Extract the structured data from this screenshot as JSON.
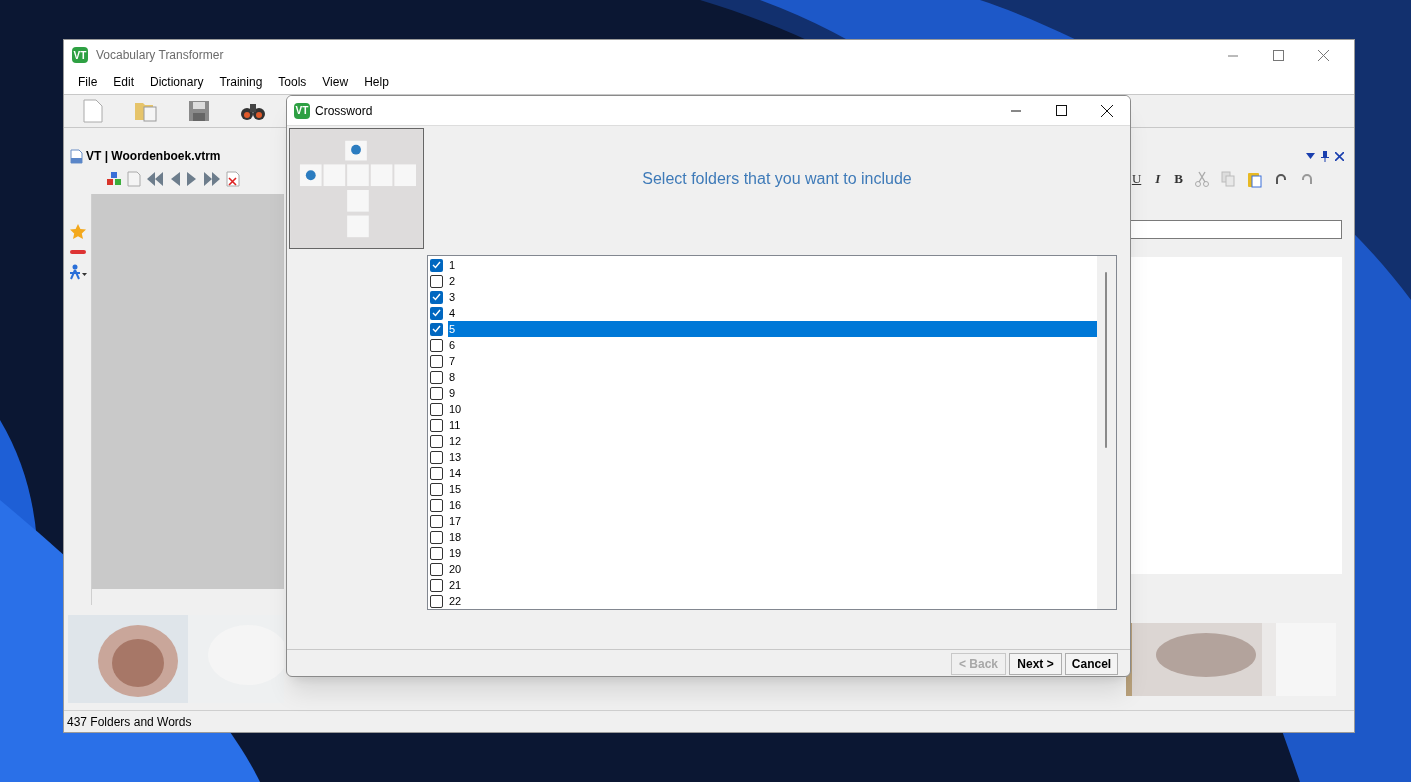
{
  "main_window": {
    "logo": "VT",
    "title": "Vocabulary Transformer",
    "menu": [
      "File",
      "Edit",
      "Dictionary",
      "Training",
      "Tools",
      "View",
      "Help"
    ],
    "document_tab": "VT | Woordenboek.vtrm",
    "format_buttons": [
      "U",
      "I",
      "B"
    ],
    "status_bar": "437 Folders and Words"
  },
  "dialog": {
    "logo": "VT",
    "title": "Crossword",
    "heading": "Select folders that you want to include",
    "folders": [
      {
        "label": "1",
        "checked": true,
        "selected": false
      },
      {
        "label": "2",
        "checked": false,
        "selected": false
      },
      {
        "label": "3",
        "checked": true,
        "selected": false
      },
      {
        "label": "4",
        "checked": true,
        "selected": false
      },
      {
        "label": "5",
        "checked": true,
        "selected": true
      },
      {
        "label": "6",
        "checked": false,
        "selected": false
      },
      {
        "label": "7",
        "checked": false,
        "selected": false
      },
      {
        "label": "8",
        "checked": false,
        "selected": false
      },
      {
        "label": "9",
        "checked": false,
        "selected": false
      },
      {
        "label": "10",
        "checked": false,
        "selected": false
      },
      {
        "label": "11",
        "checked": false,
        "selected": false
      },
      {
        "label": "12",
        "checked": false,
        "selected": false
      },
      {
        "label": "13",
        "checked": false,
        "selected": false
      },
      {
        "label": "14",
        "checked": false,
        "selected": false
      },
      {
        "label": "15",
        "checked": false,
        "selected": false
      },
      {
        "label": "16",
        "checked": false,
        "selected": false
      },
      {
        "label": "17",
        "checked": false,
        "selected": false
      },
      {
        "label": "18",
        "checked": false,
        "selected": false
      },
      {
        "label": "19",
        "checked": false,
        "selected": false
      },
      {
        "label": "20",
        "checked": false,
        "selected": false
      },
      {
        "label": "21",
        "checked": false,
        "selected": false
      },
      {
        "label": "22",
        "checked": false,
        "selected": false
      }
    ],
    "buttons": [
      {
        "label": "< Back",
        "disabled": true
      },
      {
        "label": "Next >",
        "disabled": false
      },
      {
        "label": "Cancel",
        "disabled": false
      }
    ]
  }
}
